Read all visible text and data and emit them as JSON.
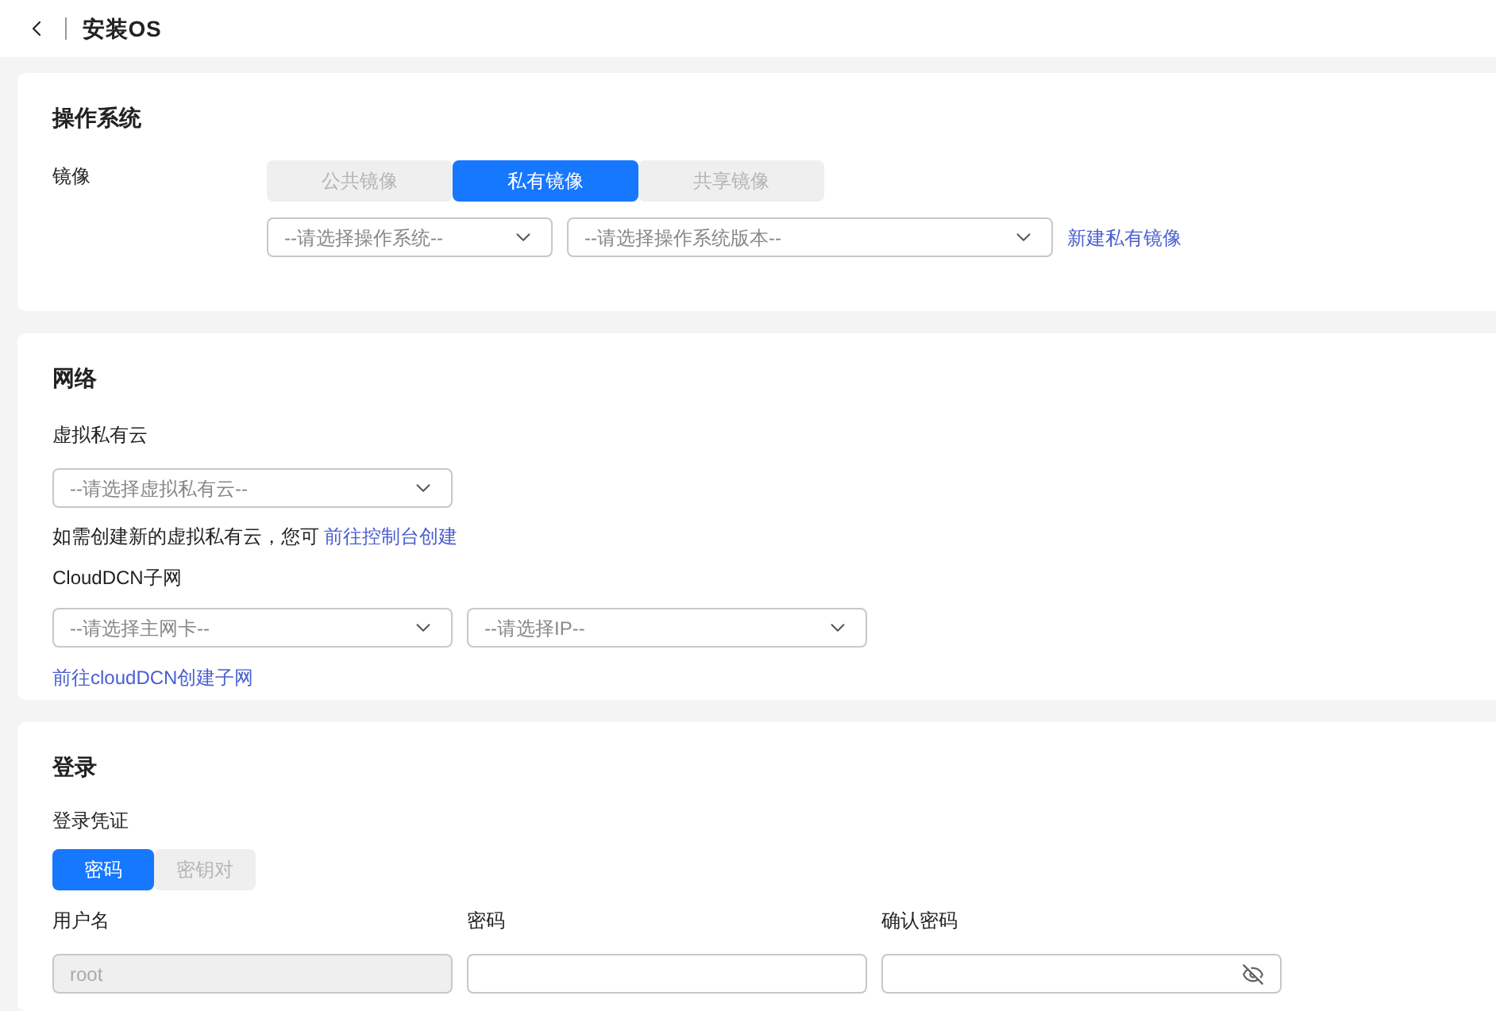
{
  "header": {
    "title": "安装OS"
  },
  "os_section": {
    "title": "操作系统",
    "label": "镜像",
    "tabs": [
      {
        "label": "公共镜像",
        "selected": false
      },
      {
        "label": "私有镜像",
        "selected": true
      },
      {
        "label": "共享镜像",
        "selected": false
      }
    ],
    "os_select": {
      "placeholder": "--请选择操作系统--"
    },
    "version_select": {
      "placeholder": "--请选择操作系统版本--"
    },
    "create_link": "新建私有镜像"
  },
  "network_section": {
    "title": "网络",
    "vpc_label": "虚拟私有云",
    "vpc_select": {
      "placeholder": "--请选择虚拟私有云--"
    },
    "hint": "如需创建新的虚拟私有云，您可",
    "hint_link": "前往控制台创建",
    "subnet_label": "CloudDCN子网",
    "nic_select": {
      "placeholder": "--请选择主网卡--"
    },
    "ip_select": {
      "placeholder": "--请选择IP--"
    },
    "subnet_link": "前往cloudDCN创建子网"
  },
  "login_section": {
    "title": "登录",
    "credential_label": "登录凭证",
    "tabs": [
      {
        "label": "密码",
        "selected": true
      },
      {
        "label": "密钥对",
        "selected": false
      }
    ],
    "fields": [
      {
        "label": "用户名",
        "value": "root",
        "disabled": true,
        "kind": "text"
      },
      {
        "label": "密码",
        "disabled": false,
        "kind": "text"
      },
      {
        "label": "确认密码",
        "disabled": false,
        "kind": "password"
      }
    ]
  }
}
